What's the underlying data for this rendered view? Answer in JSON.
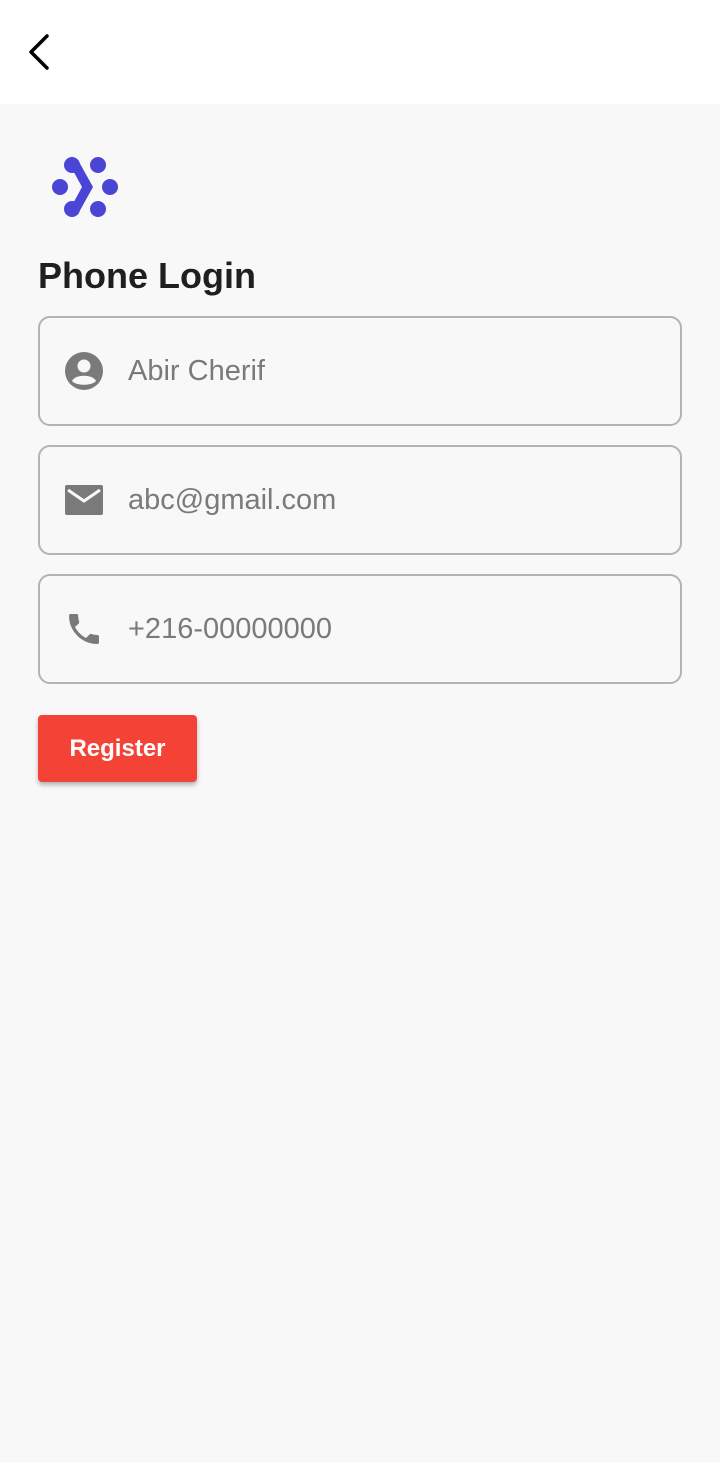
{
  "header": {
    "back_icon": "chevron-left-icon"
  },
  "logo": {
    "icon": "dots-chevron-logo",
    "color": "#4b45d6"
  },
  "page": {
    "title": "Phone Login"
  },
  "form": {
    "name": {
      "icon": "account-circle-icon",
      "value": "Abir Cherif"
    },
    "email": {
      "icon": "email-icon",
      "value": "abc@gmail.com"
    },
    "phone": {
      "icon": "phone-icon",
      "value": "+216-00000000"
    }
  },
  "actions": {
    "register_label": "Register",
    "register_color": "#f44336"
  },
  "colors": {
    "background": "#f8f8f9",
    "icon_gray": "#7a7a7a",
    "border": "#b3b3b3"
  }
}
